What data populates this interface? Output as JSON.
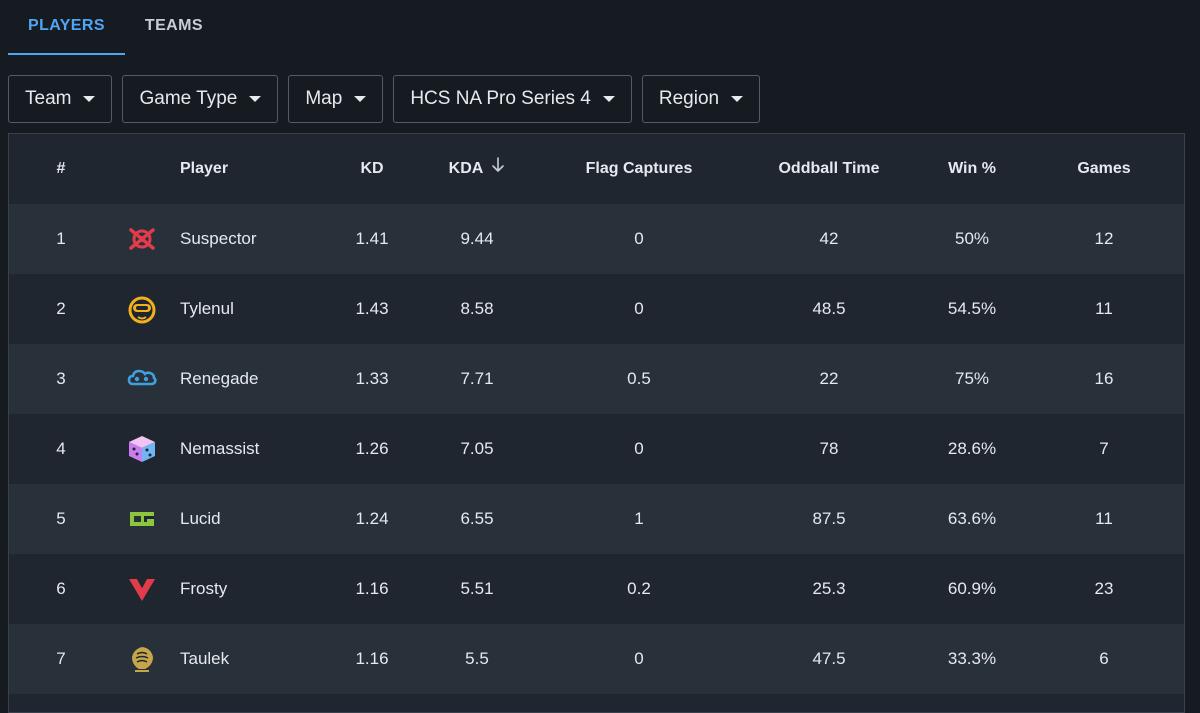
{
  "tabs": [
    {
      "label": "PLAYERS",
      "active": true
    },
    {
      "label": "TEAMS",
      "active": false
    }
  ],
  "filters": [
    {
      "label": "Team"
    },
    {
      "label": "Game Type"
    },
    {
      "label": "Map"
    },
    {
      "label": "HCS NA Pro Series 4"
    },
    {
      "label": "Region"
    }
  ],
  "table": {
    "headers": {
      "rank": "#",
      "player": "Player",
      "kd": "KD",
      "kda": "KDA",
      "flag": "Flag Captures",
      "oddball": "Oddball Time",
      "win": "Win %",
      "games": "Games"
    },
    "sorted_by": "KDA",
    "rows": [
      {
        "rank": "1",
        "logo": "sentinels-logo-icon",
        "player": "Suspector",
        "kd": "1.41",
        "kda": "9.44",
        "flag": "0",
        "oddball": "42",
        "win": "50%",
        "games": "12"
      },
      {
        "rank": "2",
        "logo": "spacestation-logo-icon",
        "player": "Tylenul",
        "kd": "1.43",
        "kda": "8.58",
        "flag": "0",
        "oddball": "48.5",
        "win": "54.5%",
        "games": "11"
      },
      {
        "rank": "3",
        "logo": "cloud9-logo-icon",
        "player": "Renegade",
        "kd": "1.33",
        "kda": "7.71",
        "flag": "0.5",
        "oddball": "22",
        "win": "75%",
        "games": "16"
      },
      {
        "rank": "4",
        "logo": "dice-logo-icon",
        "player": "Nemassist",
        "kd": "1.26",
        "kda": "7.05",
        "flag": "0",
        "oddball": "78",
        "win": "28.6%",
        "games": "7"
      },
      {
        "rank": "5",
        "logo": "optic-logo-icon",
        "player": "Lucid",
        "kd": "1.24",
        "kda": "6.55",
        "flag": "1",
        "oddball": "87.5",
        "win": "63.6%",
        "games": "11"
      },
      {
        "rank": "6",
        "logo": "sentinels-v-logo-icon",
        "player": "Frosty",
        "kd": "1.16",
        "kda": "5.51",
        "flag": "0.2",
        "oddball": "25.3",
        "win": "60.9%",
        "games": "23"
      },
      {
        "rank": "7",
        "logo": "lion-logo-icon",
        "player": "Taulek",
        "kd": "1.16",
        "kda": "5.5",
        "flag": "0",
        "oddball": "47.5",
        "win": "33.3%",
        "games": "6"
      }
    ]
  },
  "colors": {
    "accent": "#4fa6f5",
    "background": "#161b22",
    "row_alt": "#28303a",
    "row": "#1f262f"
  }
}
